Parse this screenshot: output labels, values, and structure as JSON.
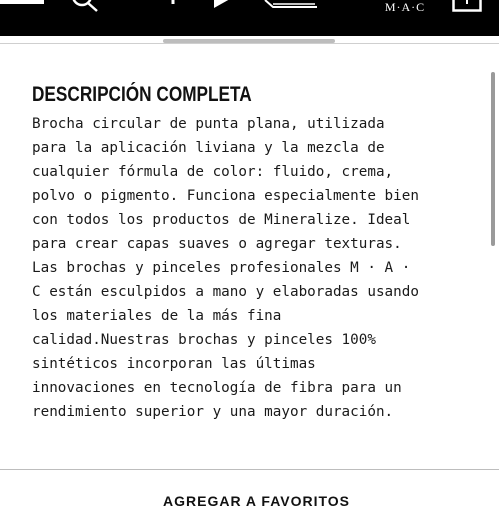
{
  "header": {
    "brand": "M·A·C",
    "background": "#000000"
  },
  "content": {
    "title": "DESCRIPCIÓN COMPLETA",
    "description_lines": [
      "Brocha circular de punta plana, utilizada",
      "para la aplicación liviana y la mezcla de",
      "cualquier fórmula de color: fluido, crema,",
      "polvo o pigmento. Funciona especialmente bien",
      "con todos los productos de Mineralize. Ideal",
      "para crear capas suaves o agregar texturas.",
      "Las brochas y pinceles profesionales M · A ·",
      "C están esculpidos a mano y elaboradas usando",
      "los materiales de la más fina",
      "calidad.Nuestras brochas y pinceles 100%",
      "sintéticos incorporan las últimas",
      "innovaciones en tecnología de fibra para un",
      "rendimiento superior y una mayor duración."
    ]
  },
  "footer": {
    "favorites_label": "AGREGAR A FAVORITOS"
  }
}
